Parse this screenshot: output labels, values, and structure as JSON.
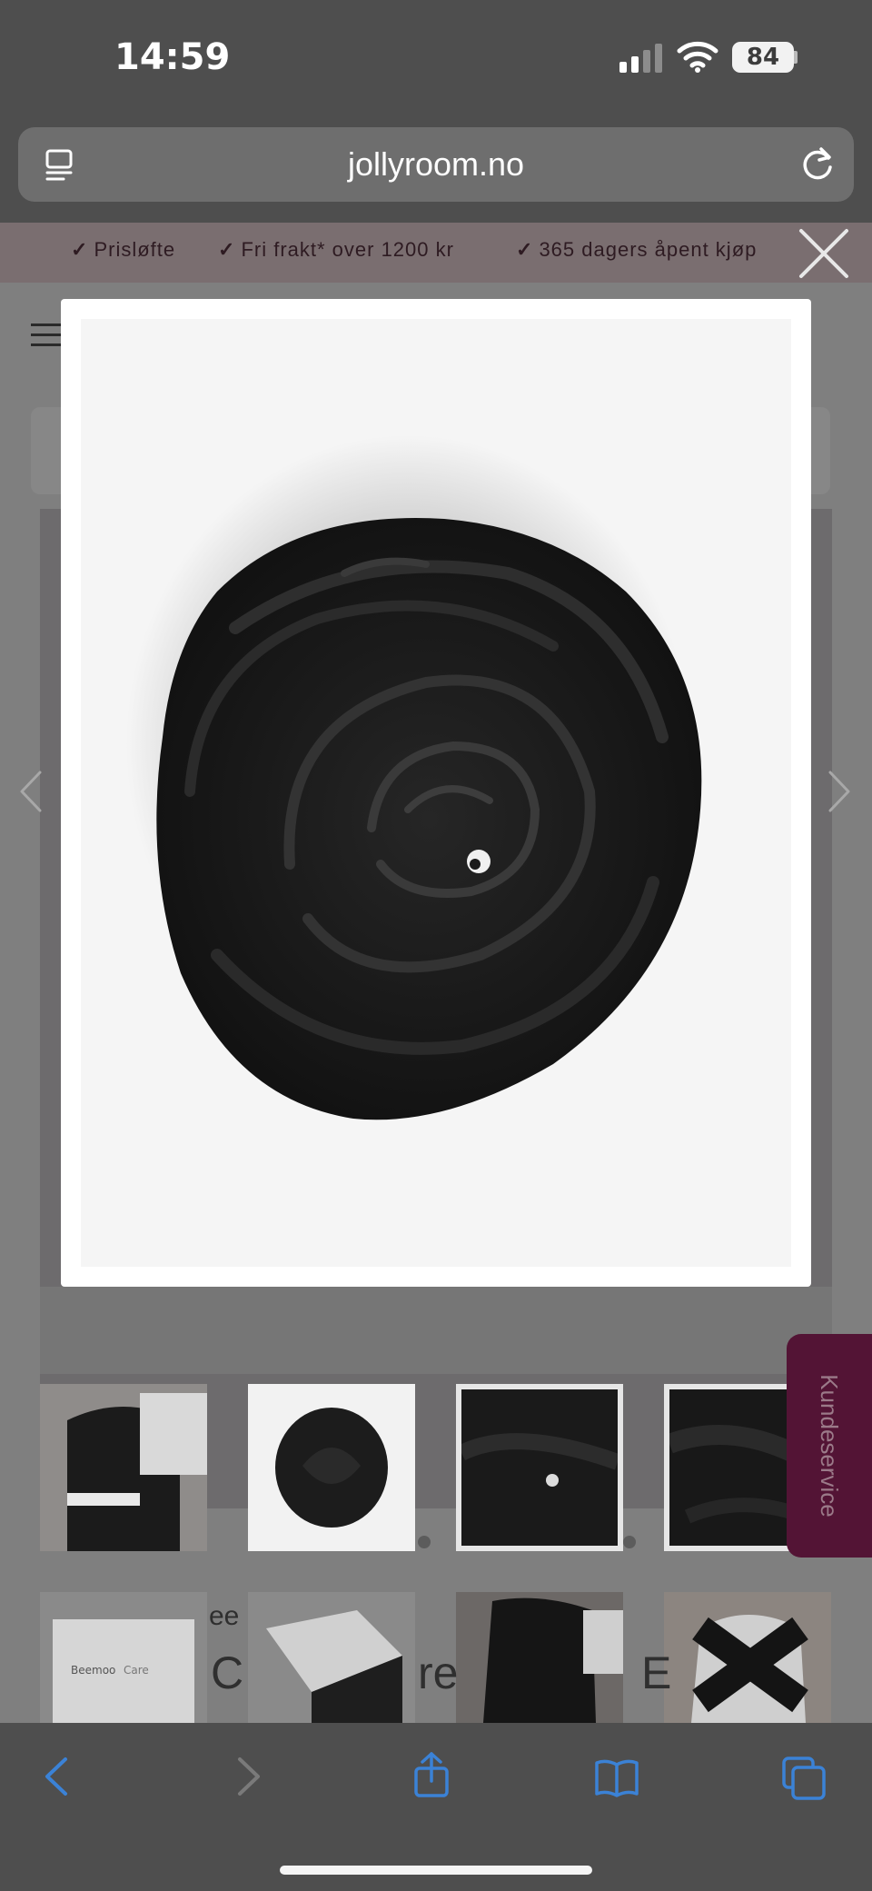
{
  "status_bar": {
    "time": "14:59",
    "battery": "84"
  },
  "browser": {
    "url": "jollyroom.no"
  },
  "promo": {
    "items": [
      {
        "check": "✓",
        "text": "Prisløfte"
      },
      {
        "check": "✓",
        "text": "Fri frakt* over 1200 kr"
      },
      {
        "check": "✓",
        "text": "365 dagers åpent kjøp"
      }
    ]
  },
  "side_tab": {
    "label": "Kundeservice"
  },
  "background_text": {
    "brand_fragment": "ee",
    "title_fragment_1": "C",
    "title_fragment_2": "re",
    "title_fragment_3": "E"
  },
  "product_box": {
    "brand": "Beemoo",
    "line": "Care"
  },
  "modal": {
    "image_label": "rolled black baby wrap carrier",
    "logo_glyph": "◕"
  },
  "colors": {
    "side_tab": "#531435",
    "promo_text": "#2e1b22",
    "toolbar_icons": "#3b82d6"
  }
}
